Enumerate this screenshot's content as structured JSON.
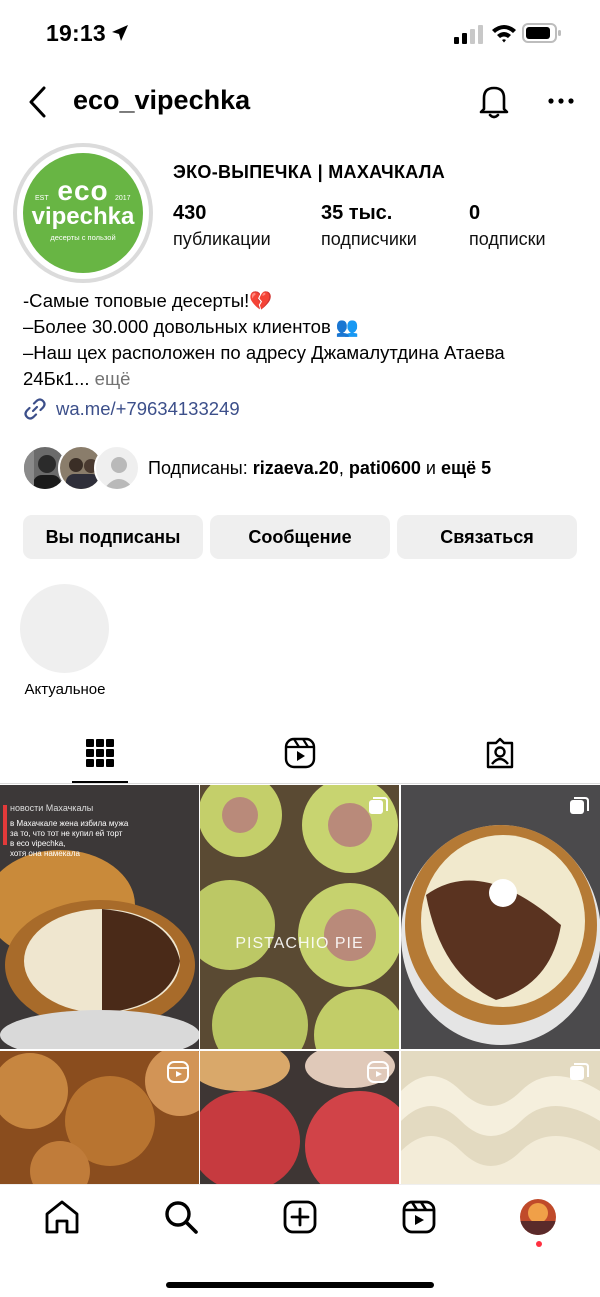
{
  "status_bar": {
    "time": "19:13"
  },
  "header": {
    "username": "eco_vipechka"
  },
  "profile": {
    "logo": {
      "line1": "eco",
      "line2": "vipechka",
      "est": "EST",
      "year": "2017",
      "tagline": "десерты с пользой"
    },
    "full_name": "ЭКО-ВЫПЕЧКА | МАХАЧКАЛА",
    "stats": [
      {
        "value": "430",
        "label": "публикации"
      },
      {
        "value": "35 тыс.",
        "label": "подписчики"
      },
      {
        "value": "0",
        "label": "подписки"
      }
    ],
    "bio": {
      "line1": "-Самые топовые десерты!💔",
      "line2": "–Более 30.000 довольных клиентов 👥",
      "line3": "–Наш цех расположен по адресу Джамалутдина Атаева",
      "line4": "24Бк1...",
      "more": "ещё"
    },
    "link": "wa.me/+79634133249",
    "followed_by": {
      "prefix": "Подписаны: ",
      "user1": "rizaeva.20",
      "sep": ", ",
      "user2": "pati0600",
      "suffix_and": " и ",
      "more": "ещё 5"
    }
  },
  "buttons": {
    "following": "Вы подписаны",
    "message": "Сообщение",
    "contact": "Связаться"
  },
  "highlights": {
    "label": "Актуальное"
  },
  "posts": {
    "post1_overlay_title": "новости Махачкалы",
    "post1_overlay_l1": "в Махачкале жена избила мужа",
    "post1_overlay_l2": "за то, что тот не купил ей торт",
    "post1_overlay_l3": "в eco vipechka,",
    "post1_overlay_l4": "хотя она намекала",
    "post2_caption": "PISTACHIO PIE"
  },
  "colors": {
    "brand_green": "#68b544",
    "button_bg": "#efefef",
    "link": "#3c4f8a",
    "notification_dot": "#ff3040"
  }
}
